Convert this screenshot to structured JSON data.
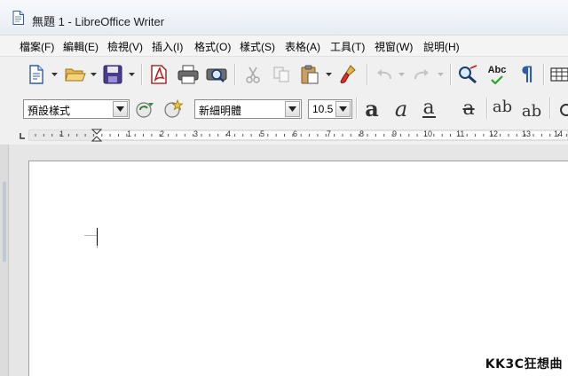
{
  "window": {
    "title": "無題 1 - LibreOffice Writer"
  },
  "menubar": {
    "items": [
      "檔案(F)",
      "編輯(E)",
      "檢視(V)",
      "插入(I)",
      "格式(O)",
      "樣式(S)",
      "表格(A)",
      "工具(T)",
      "視窗(W)",
      "說明(H)"
    ]
  },
  "toolbar": {
    "buttons": [
      "new-document-icon",
      "open-folder-icon",
      "save-floppy-icon",
      "export-pdf-icon",
      "print-icon",
      "print-preview-icon",
      "cut-scissors-icon",
      "copy-icon",
      "paste-clipboard-icon",
      "clone-formatting-brush-icon",
      "undo-icon",
      "redo-icon",
      "find-replace-icon",
      "spelling-icon",
      "formatting-marks-icon"
    ],
    "spellcheck_label": "Abc",
    "pilcrow": "¶"
  },
  "formatting": {
    "paragraph_style": "預設樣式",
    "font_name": "新細明體",
    "font_size": "10.5",
    "bold_glyph": "a",
    "italic_glyph": "a",
    "underline_glyph": "a",
    "strike_glyph": "a",
    "superscript_glyph": "ab",
    "subscript_glyph": "ab"
  },
  "ruler": {
    "tick_labels": [
      "1",
      "1",
      "2",
      "3",
      "4",
      "5",
      "6",
      "7",
      "8",
      "9",
      "10",
      "11",
      "12",
      "13",
      "14"
    ]
  },
  "watermark": "KK3C狂想曲",
  "colors": {
    "titlebar": "#eef2f7",
    "toolbar": "#f0f0f0",
    "page": "#ffffff",
    "workspace": "#e6e6e6"
  }
}
